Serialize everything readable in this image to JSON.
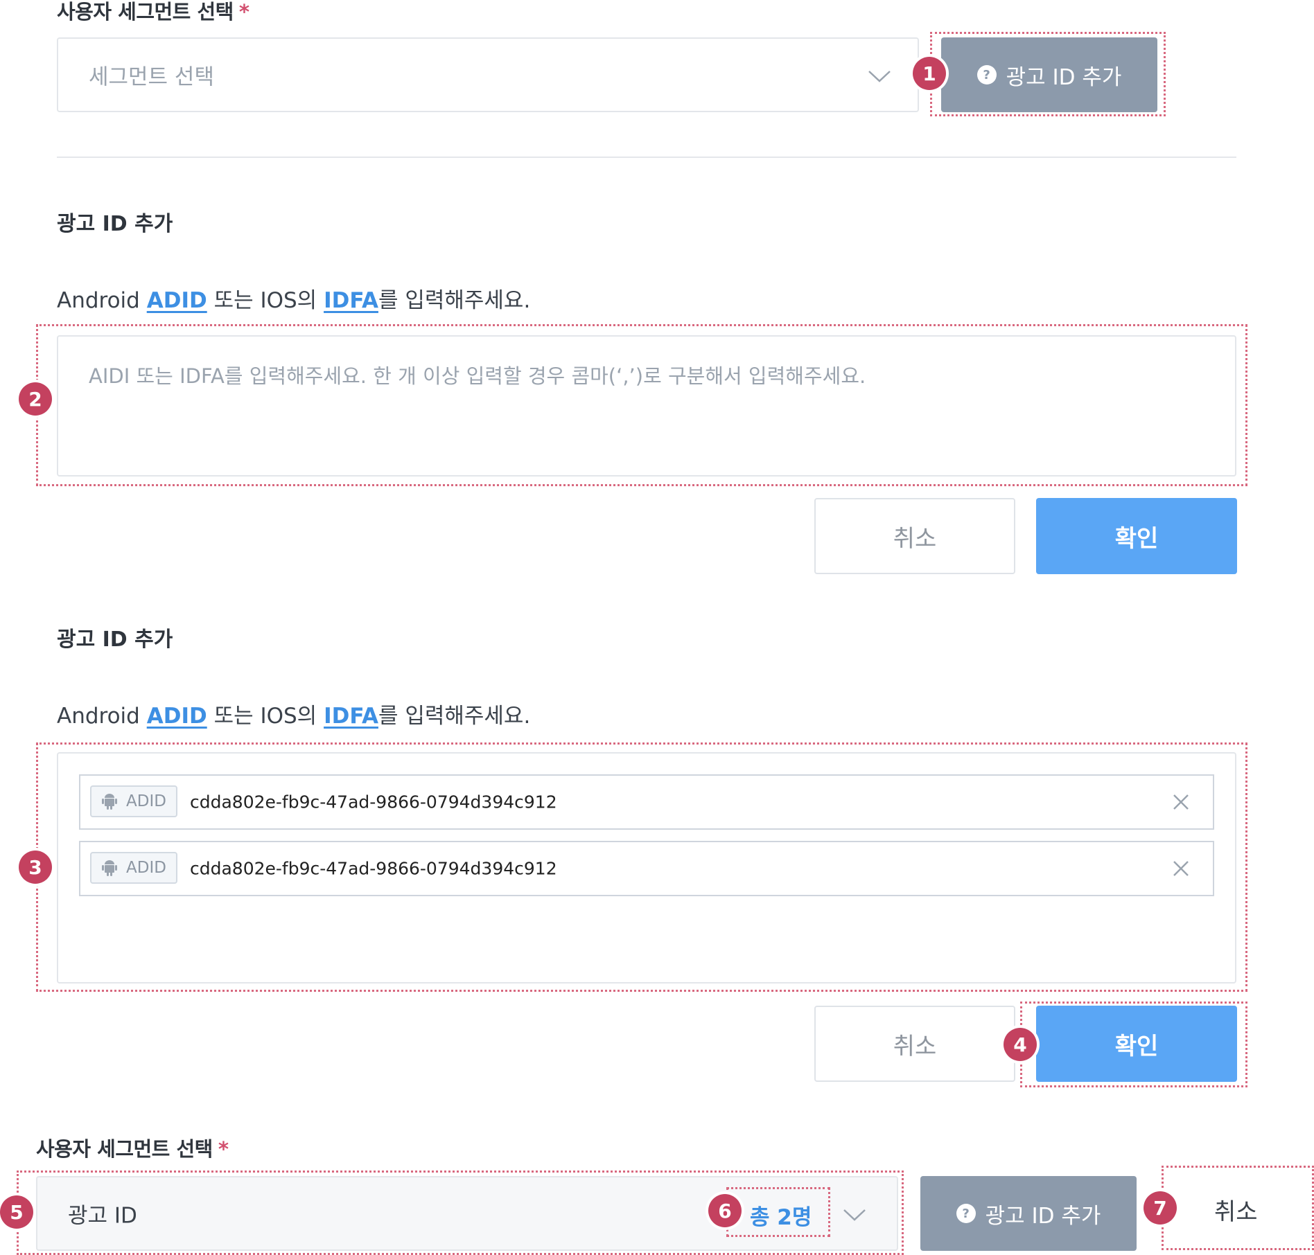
{
  "top_section": {
    "label": "사용자 세그먼트 선택",
    "required_mark": "*",
    "segment_placeholder": "세그먼트 선택",
    "add_ad_id_button": "광고 ID 추가"
  },
  "empty_form": {
    "title": "광고 ID 추가",
    "desc_prefix": "Android ",
    "desc_link1": "ADID",
    "desc_mid": " 또는 IOS의 ",
    "desc_link2": "IDFA",
    "desc_suffix": "를 입력해주세요.",
    "textarea_placeholder": "AIDI 또는 IDFA를 입력해주세요. 한 개 이상 입력할 경우 콤마(‘,’)로 구분해서 입력해주세요.",
    "cancel_label": "취소",
    "confirm_label": "확인"
  },
  "filled_form": {
    "title": "광고 ID 추가",
    "desc_prefix": "Android ",
    "desc_link1": "ADID",
    "desc_mid": " 또는 IOS의 ",
    "desc_link2": "IDFA",
    "desc_suffix": "를 입력해주세요.",
    "entries": [
      {
        "tag": "ADID",
        "value": "cdda802e-fb9c-47ad-9866-0794d394c912"
      },
      {
        "tag": "ADID",
        "value": "cdda802e-fb9c-47ad-9866-0794d394c912"
      }
    ],
    "cancel_label": "취소",
    "confirm_label": "확인"
  },
  "bottom_section": {
    "label": "사용자 세그먼트 선택",
    "required_mark": "*",
    "selected_value": "광고 ID",
    "total_count": "총 2명",
    "add_ad_id_button": "광고 ID 추가",
    "cancel_label": "취소"
  },
  "markers": [
    "1",
    "2",
    "3",
    "4",
    "5",
    "6",
    "7"
  ],
  "icons": {
    "help": "?"
  },
  "colors": {
    "marker": "#c4415f",
    "highlight_border": "#d8687f",
    "primary": "#5aa6f5",
    "link": "#3d8fe3",
    "gray_button": "#8c9aab"
  }
}
